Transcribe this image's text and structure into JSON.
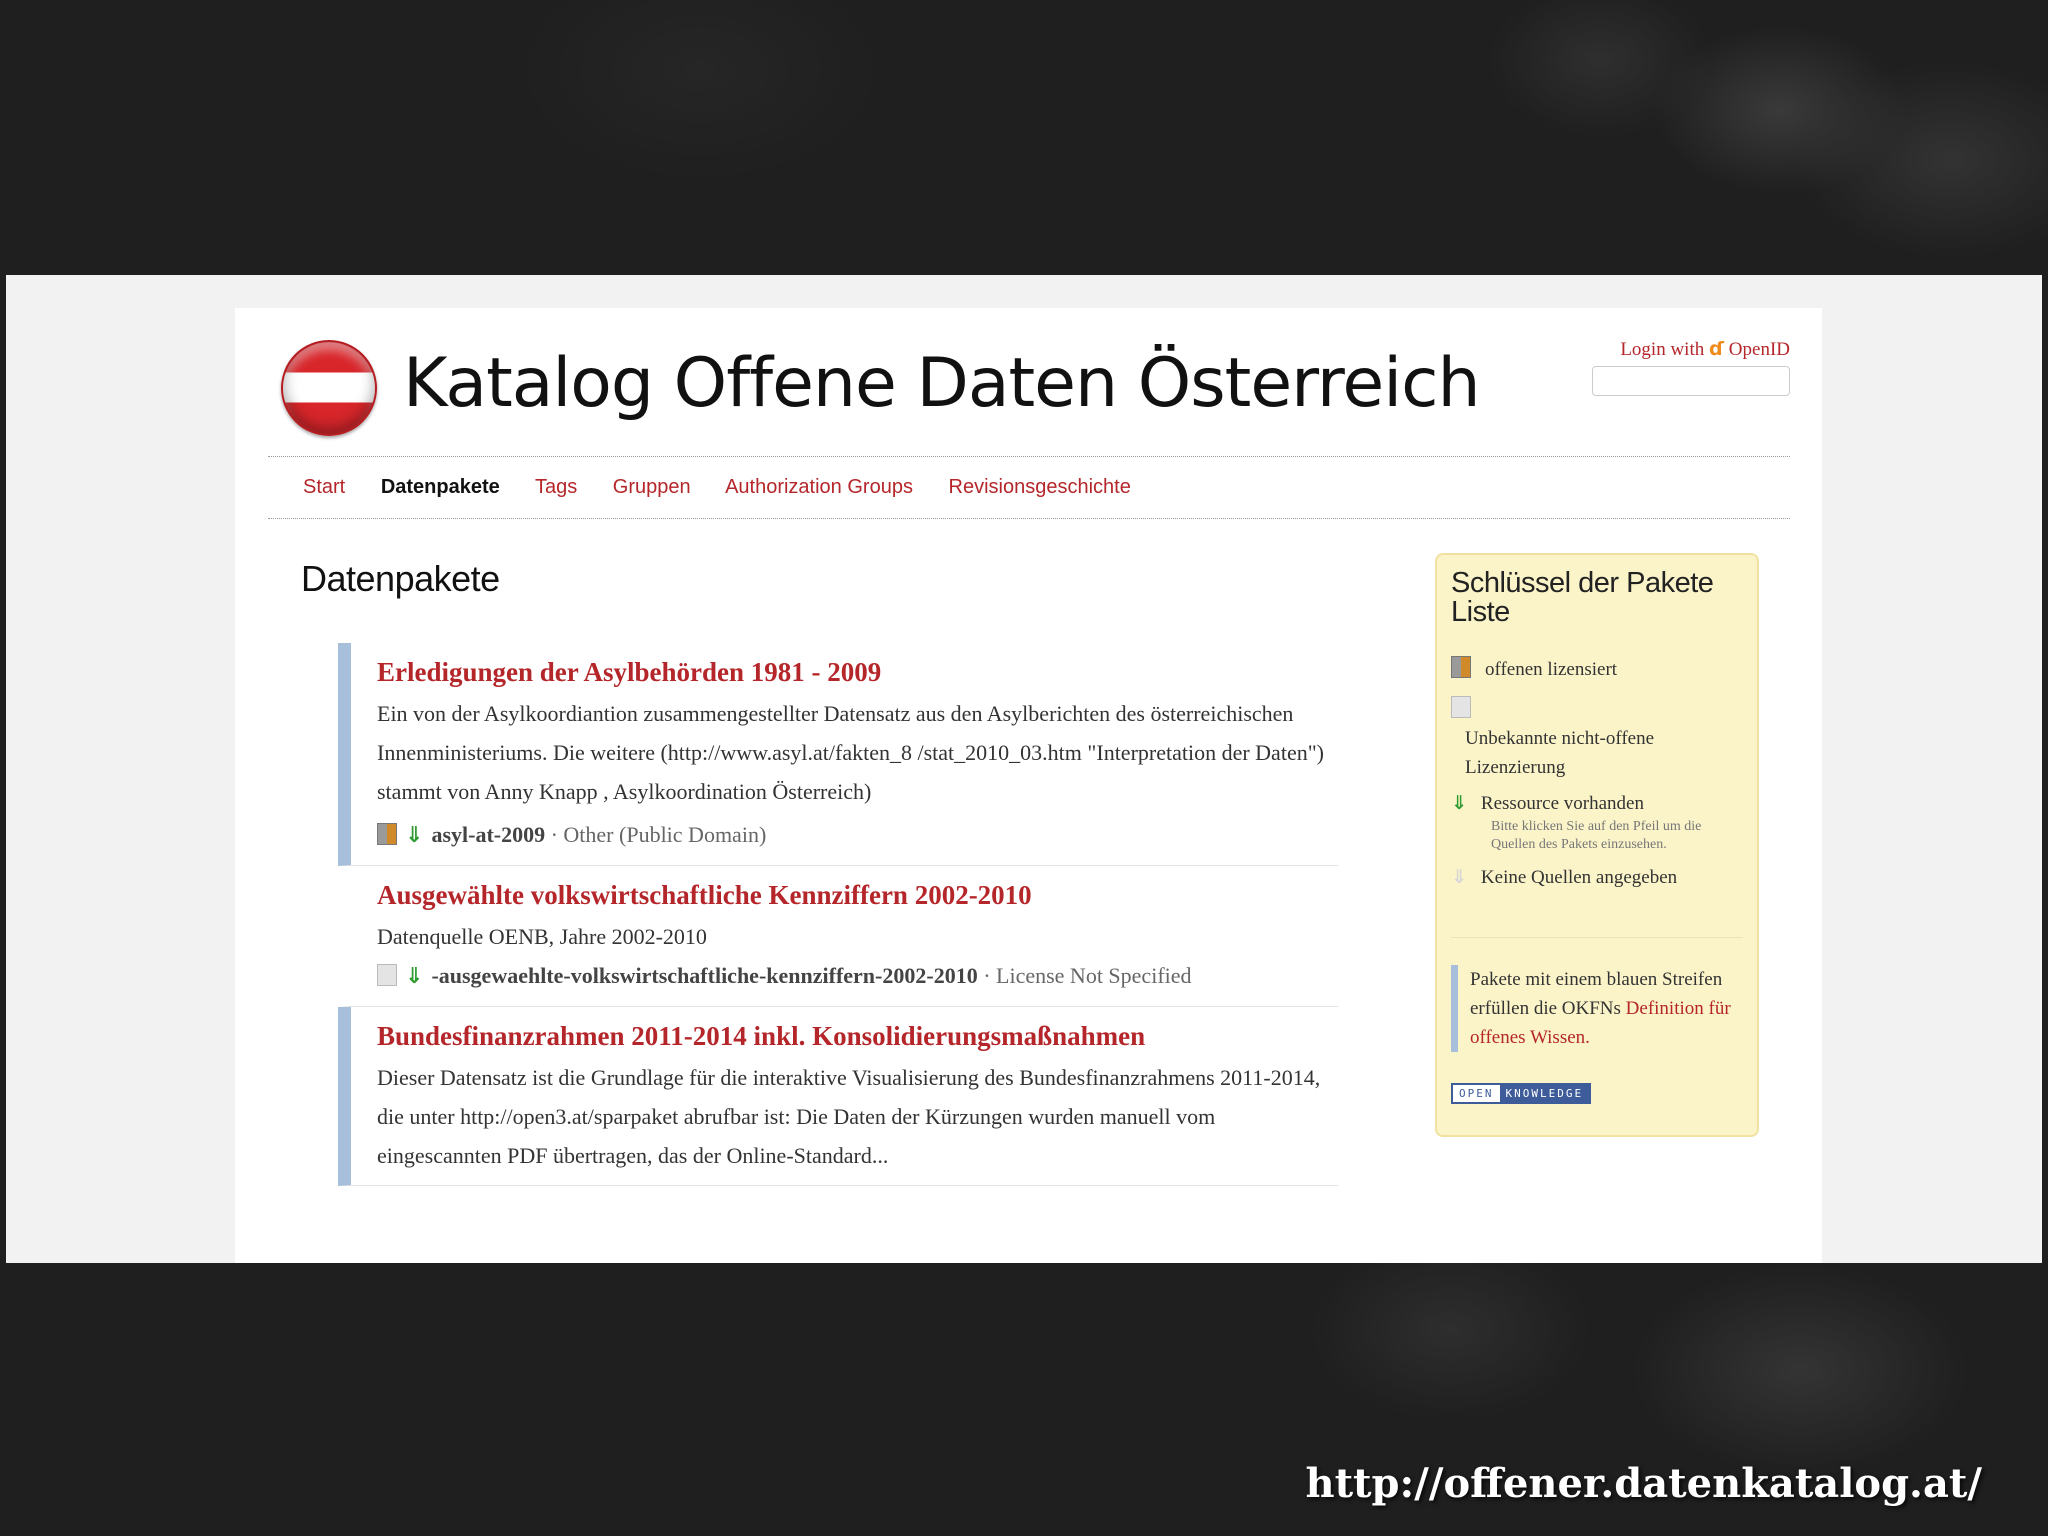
{
  "site": {
    "title": "Katalog Offene Daten Österreich",
    "login_text": "Login with",
    "login_provider": "OpenID"
  },
  "nav": {
    "items": [
      {
        "label": "Start",
        "active": false
      },
      {
        "label": "Datenpakete",
        "active": true
      },
      {
        "label": "Tags",
        "active": false
      },
      {
        "label": "Gruppen",
        "active": false
      },
      {
        "label": "Authorization Groups",
        "active": false
      },
      {
        "label": "Revisionsgeschichte",
        "active": false
      }
    ]
  },
  "main": {
    "heading": "Datenpakete",
    "packages": [
      {
        "title": "Erledigungen der Asylbehörden 1981 - 2009",
        "description": "Ein von der Asylkoordiantion zusammengestellter Datensatz aus den Asylberichten des österreichischen Innenministeriums. Die weitere (http://www.asyl.at/fakten_8 /stat_2010_03.htm \"Interpretation der Daten\") stammt von Anny Knapp , Asylkoordination Österreich)",
        "name": "asyl-at-2009",
        "license": "· Other (Public Domain)"
      },
      {
        "title": "Ausgewählte volkswirtschaftliche Kennziffern 2002-2010",
        "description": "Datenquelle OENB, Jahre 2002-2010",
        "name": "-ausgewaehlte-volkswirtschaftliche-kennziffern-2002-2010",
        "license": "· License Not Specified"
      },
      {
        "title": "Bundesfinanzrahmen 2011-2014 inkl. Konsolidierungsmaßnahmen",
        "description": "Dieser Datensatz ist die Grundlage für die interaktive Visualisierung des Bundesfinanzrahmens 2011-2014, die unter http://open3.at/sparpaket abrufbar ist: Die Daten der Kürzungen wurden manuell vom eingescannten PDF übertragen, das der Online-Standard..."
      }
    ]
  },
  "sidebar": {
    "title": "Schlüssel der Pakete Liste",
    "open_licensed": "offenen lizensiert",
    "unknown_license": "Unbekannte nicht-offene Lizenzierung",
    "resource_available": "Ressource vorhanden",
    "resource_note": "Bitte klicken Sie auf den Pfeil um die Quellen des Pakets einzusehen.",
    "no_sources": "Keine Quellen angegeben",
    "okfn_text": "Pakete mit einem blauen Streifen erfüllen die OKFNs",
    "okfn_link": "Definition für offenes Wissen.",
    "badge_open": "OPEN",
    "badge_knowledge": "KNOWLEDGE"
  },
  "footer": {
    "url": "http://offener.datenkatalog.at/"
  },
  "colors": {
    "accent_red": "#b5262a",
    "open_stripe": "#a8bfdc",
    "sidebar_bg": "#fbf4c9"
  }
}
